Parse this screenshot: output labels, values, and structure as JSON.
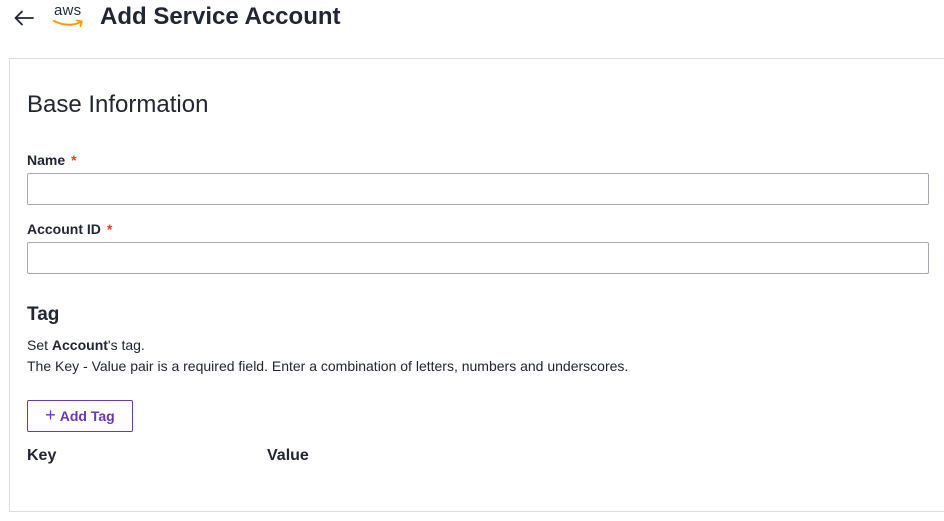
{
  "header": {
    "logo_text": "aws",
    "title": "Add Service Account"
  },
  "base_info": {
    "section_title": "Base Information",
    "name": {
      "label": "Name",
      "required_mark": "*",
      "value": "",
      "placeholder": ""
    },
    "account_id": {
      "label": "Account ID",
      "required_mark": "*",
      "value": "",
      "placeholder": ""
    }
  },
  "tag": {
    "title": "Tag",
    "desc_prefix": "Set ",
    "desc_bold": "Account",
    "desc_suffix": "'s tag.",
    "desc_line2": "The Key - Value pair is a required field. Enter a combination of letters, numbers and underscores.",
    "add_button_label": "Add Tag",
    "columns": [
      "Key",
      "Value"
    ]
  },
  "colors": {
    "accent": "#6638b6",
    "required": "#e2401b",
    "aws_orange": "#ff9900",
    "text": "#222532",
    "border": "#dcdde2"
  }
}
